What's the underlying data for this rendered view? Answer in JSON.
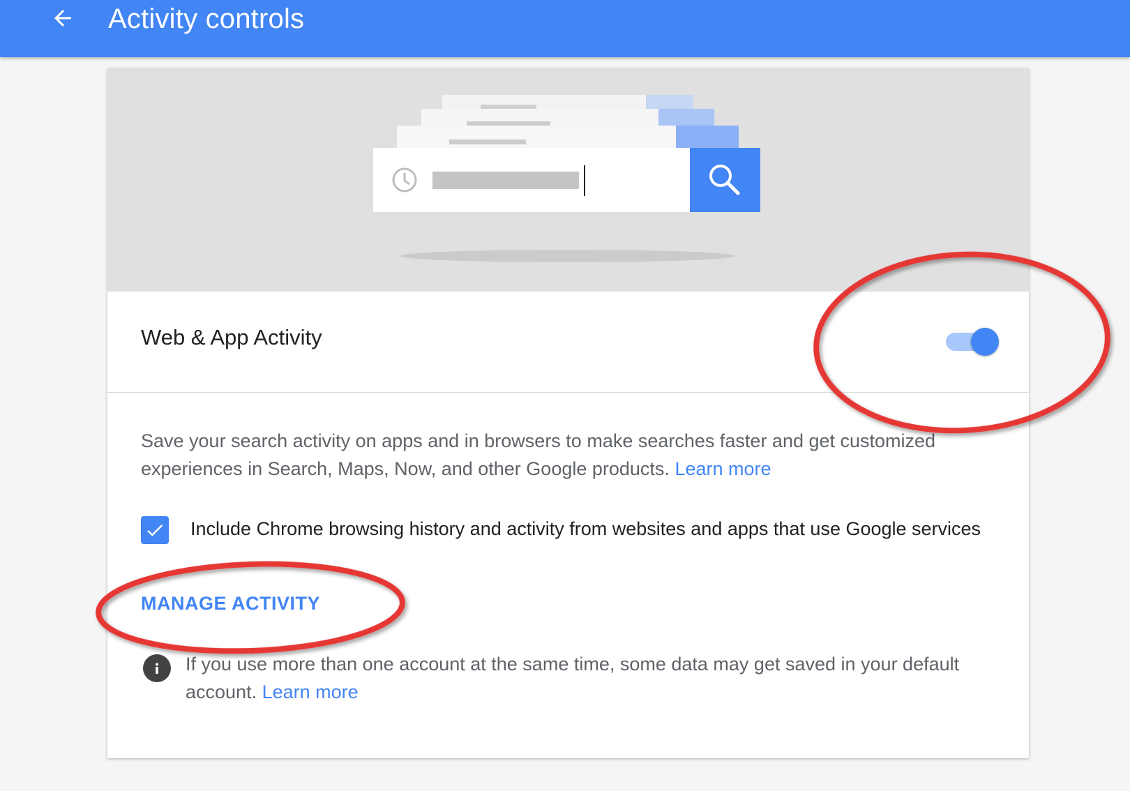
{
  "header": {
    "title": "Activity controls",
    "back_icon": "arrow-back-icon",
    "color": "#4285f4"
  },
  "setting": {
    "title": "Web & App Activity",
    "toggle_on": true,
    "description": "Save your search activity on apps and in browsers to make searches faster and get customized experiences in Search, Maps, Now, and other Google products.",
    "learn_more": "Learn more"
  },
  "chrome_history": {
    "checked": true,
    "label": "Include Chrome browsing history and activity from websites and apps that use Google services"
  },
  "manage_activity": {
    "label": "MANAGE ACTIVITY"
  },
  "info": {
    "icon": "info-icon",
    "text": "If you use more than one account at the same time, some data may get saved in your default account.",
    "learn_more": "Learn more"
  },
  "annotation_color": "#e53935"
}
